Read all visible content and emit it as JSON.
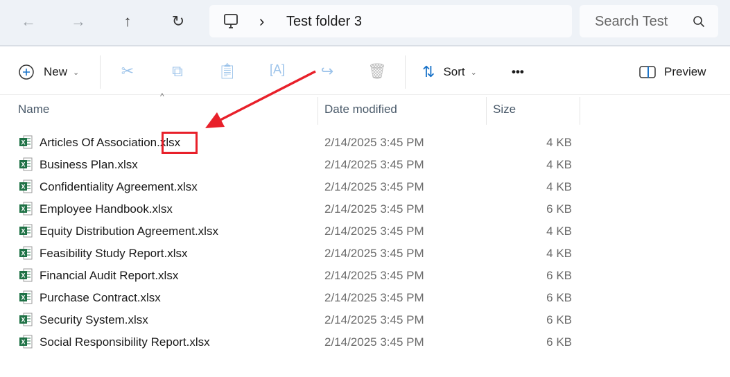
{
  "nav": {
    "back": "←",
    "forward": "→",
    "up": "↑",
    "refresh": "↻"
  },
  "address": {
    "separator": "›",
    "folder": "Test folder 3"
  },
  "search": {
    "placeholder": "Search Test f"
  },
  "toolbar": {
    "new": "New",
    "sort": "Sort",
    "more": "•••",
    "preview": "Preview"
  },
  "columns": {
    "name": "Name",
    "date": "Date modified",
    "size": "Size"
  },
  "files": [
    {
      "name": "Articles Of Association.xlsx",
      "date": "2/14/2025 3:45 PM",
      "size": "4 KB"
    },
    {
      "name": "Business Plan.xlsx",
      "date": "2/14/2025 3:45 PM",
      "size": "4 KB"
    },
    {
      "name": "Confidentiality Agreement.xlsx",
      "date": "2/14/2025 3:45 PM",
      "size": "4 KB"
    },
    {
      "name": "Employee Handbook.xlsx",
      "date": "2/14/2025 3:45 PM",
      "size": "6 KB"
    },
    {
      "name": "Equity Distribution Agreement.xlsx",
      "date": "2/14/2025 3:45 PM",
      "size": "4 KB"
    },
    {
      "name": "Feasibility Study Report.xlsx",
      "date": "2/14/2025 3:45 PM",
      "size": "4 KB"
    },
    {
      "name": "Financial Audit Report.xlsx",
      "date": "2/14/2025 3:45 PM",
      "size": "6 KB"
    },
    {
      "name": "Purchase Contract.xlsx",
      "date": "2/14/2025 3:45 PM",
      "size": "6 KB"
    },
    {
      "name": "Security System.xlsx",
      "date": "2/14/2025 3:45 PM",
      "size": "6 KB"
    },
    {
      "name": "Social Responsibility Report.xlsx",
      "date": "2/14/2025 3:45 PM",
      "size": "6 KB"
    }
  ],
  "colors": {
    "annotation": "#e8202a",
    "excel": "#1e7145"
  }
}
